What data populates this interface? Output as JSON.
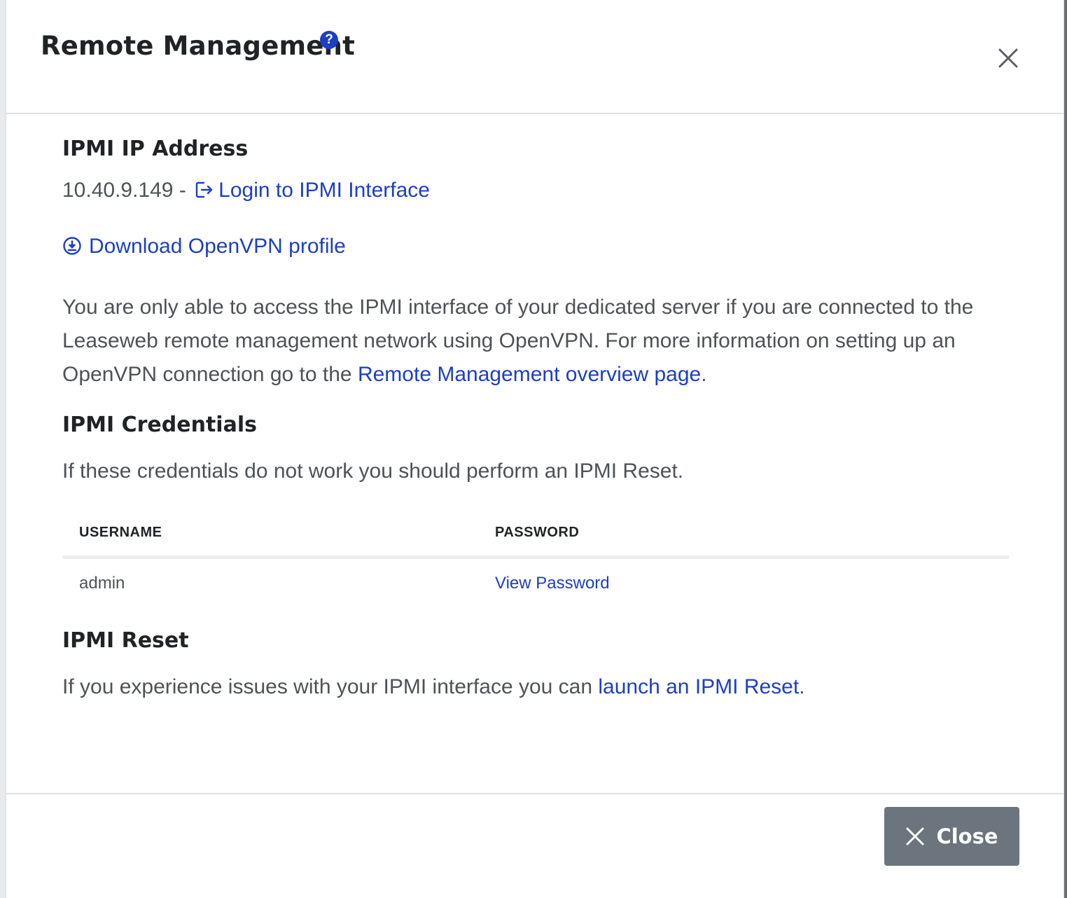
{
  "modal": {
    "title": "Remote Management",
    "help_icon_glyph": "?",
    "icons": {
      "help": "question-circle-icon",
      "close": "close-icon"
    }
  },
  "ipmi_address": {
    "heading": "IPMI IP Address",
    "ip": "10.40.9.149",
    "separator": " - ",
    "login_link": "Login to IPMI Interface",
    "login_icon": "external-login-icon"
  },
  "vpn": {
    "download_link": "Download OpenVPN profile",
    "download_icon": "download-circle-icon",
    "info_before": "You are only able to access the IPMI interface of your dedicated server if you are connected to the Leaseweb remote management network using OpenVPN. For more information on setting up an OpenVPN connection go to the ",
    "info_link": "Remote Management overview page",
    "info_after": "."
  },
  "credentials": {
    "heading": "IPMI Credentials",
    "note": "If these credentials do not work you should perform an IPMI Reset.",
    "columns": [
      "USERNAME",
      "PASSWORD"
    ],
    "rows": [
      {
        "username": "admin",
        "password_action": "View Password"
      }
    ]
  },
  "reset": {
    "heading": "IPMI Reset",
    "text_before": "If you experience issues with your IPMI interface you can ",
    "link": "launch an IPMI Reset",
    "text_after": "."
  },
  "footer": {
    "close_label": "Close"
  },
  "colors": {
    "link": "#1c3fc3",
    "button_bg": "#6c757d",
    "overlay": "#6c6f73"
  }
}
